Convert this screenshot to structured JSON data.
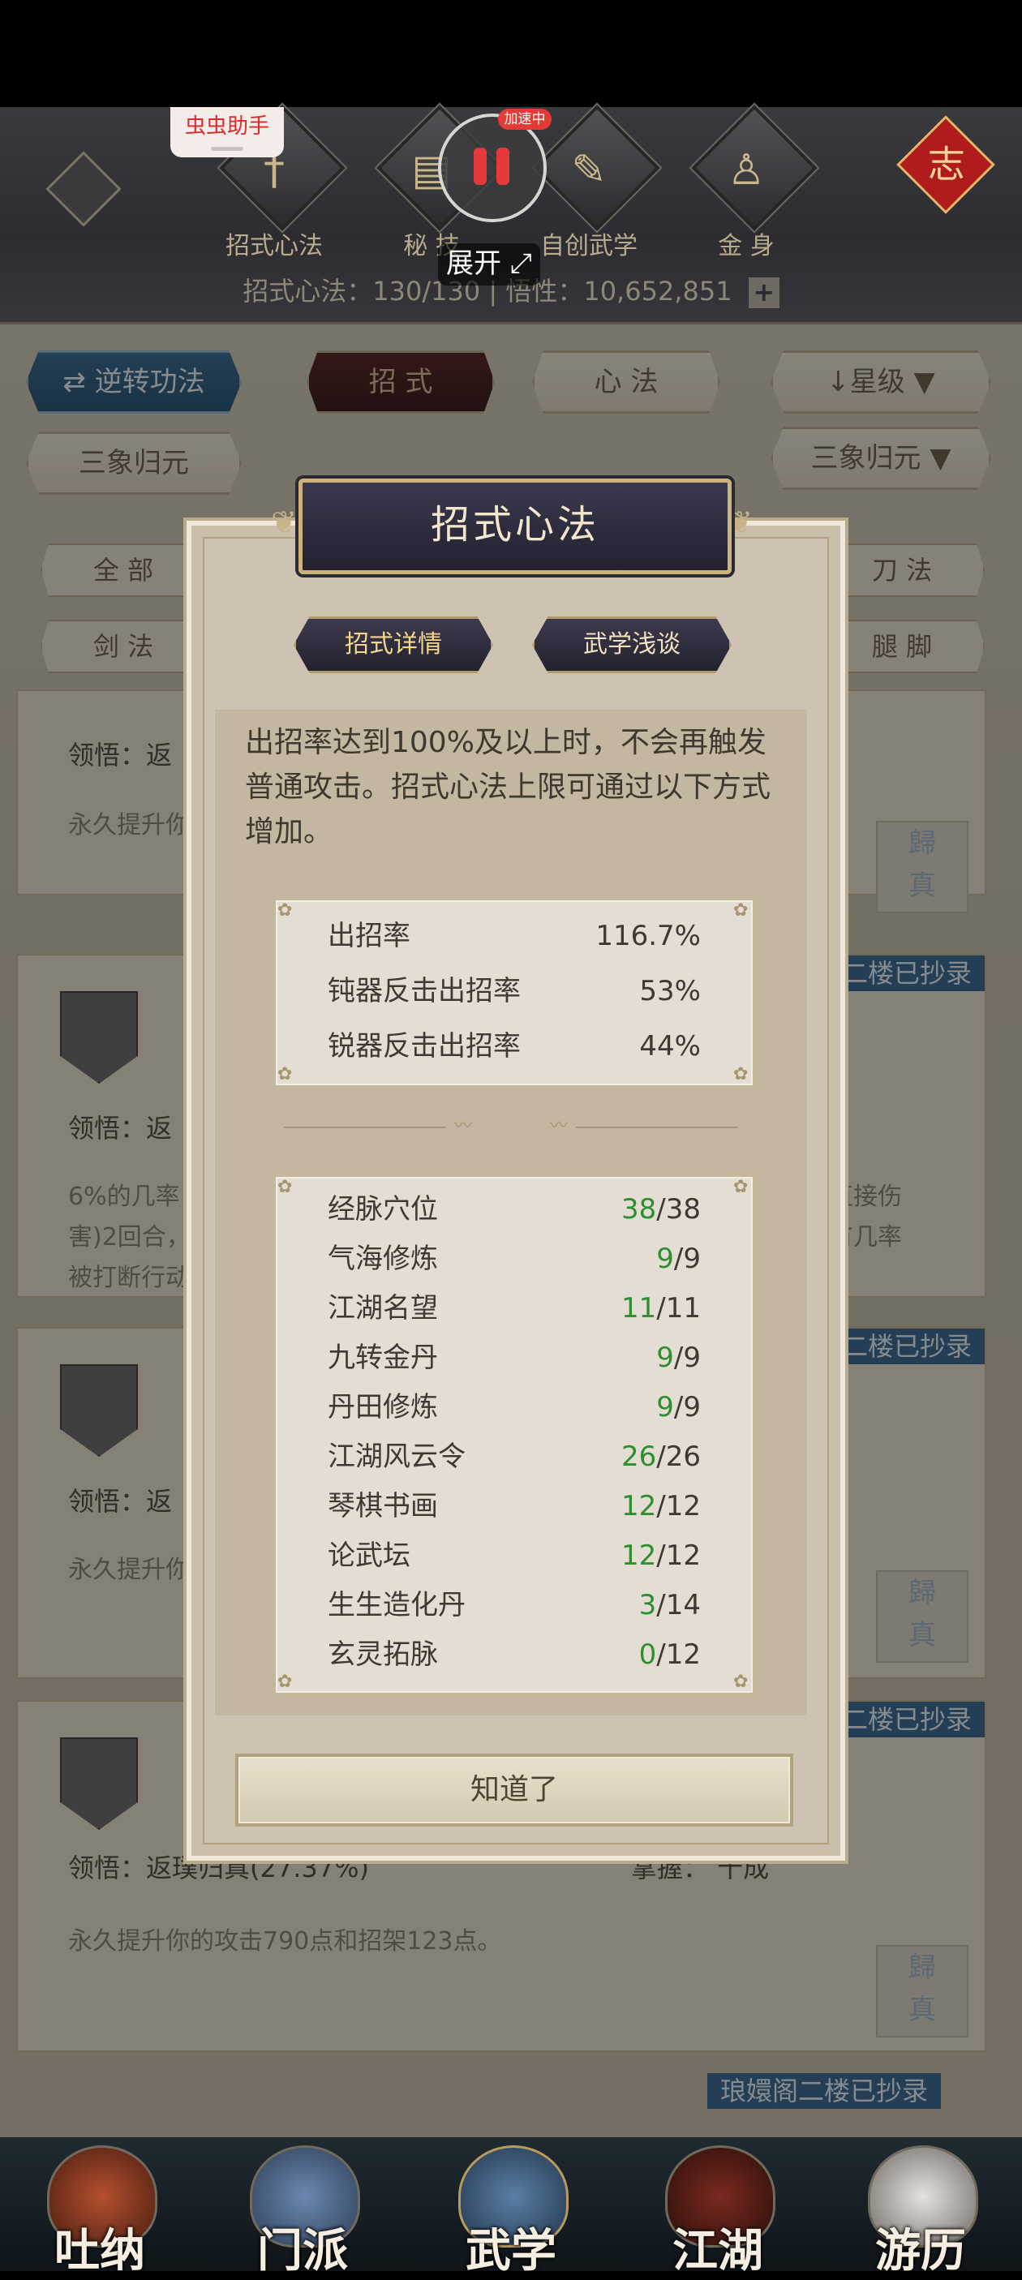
{
  "header": {
    "nav": [
      {
        "label": "招式心法",
        "icon": "sword-icon"
      },
      {
        "label": "秘  技",
        "icon": "book-icon"
      },
      {
        "label": "自创武学",
        "icon": "scroll-icon"
      },
      {
        "label": "金  身",
        "icon": "meditation-icon"
      }
    ],
    "stats_text": "招式心法：130/130  |  悟性：10,652,851",
    "plus_label": "+",
    "knot_glyph": "志"
  },
  "overlay_controls": {
    "helper_label": "虫虫助手",
    "recording_badge": "加速中",
    "expand_label": "展开"
  },
  "filters": {
    "reverse_label": "逆转功法",
    "tab_moves": "招  式",
    "tab_heart": "心  法",
    "sort_label": "星级",
    "left_select": "三象归元",
    "right_select": "三象归元",
    "cat_all": "全  部",
    "cat_blade": "刀  法",
    "cat_sword": "剑  法",
    "cat_leg": "腿  脚"
  },
  "cards": [
    {
      "realize": "领悟：返",
      "desc": "永久提升你"
    },
    {
      "realize": "领悟：返",
      "desc": "6%的几率",
      "desc2": "害)2回合，",
      "desc3": "被打断行动",
      "right1": "直接伤",
      "right2": "有几率",
      "badge": "二楼已抄录"
    },
    {
      "realize": "领悟：返",
      "desc": "永久提升你",
      "badge": "二楼已抄录"
    },
    {
      "realize": "领悟：返璞归真(27.37%)",
      "master": "掌握：  十成",
      "desc": "永久提升你的攻击790点和招架123点。",
      "badge": "二楼已抄录"
    },
    {
      "badge": "琅嬛阁二楼已抄录"
    }
  ],
  "dialog": {
    "title": "招式心法",
    "tab_detail": "招式详情",
    "tab_talk": "武学浅谈",
    "description": "出招率达到100%及以上时，不会再触发普通攻击。招式心法上限可通过以下方式增加。",
    "rates": [
      {
        "label": "出招率",
        "value": "116.7%"
      },
      {
        "label": "钝器反击出招率",
        "value": "53%"
      },
      {
        "label": "锐器反击出招率",
        "value": "44%"
      }
    ],
    "sources": [
      {
        "label": "经脉穴位",
        "current": "38",
        "max": "/38"
      },
      {
        "label": "气海修炼",
        "current": "9",
        "max": "/9"
      },
      {
        "label": "江湖名望",
        "current": "11",
        "max": "/11"
      },
      {
        "label": "九转金丹",
        "current": "9",
        "max": "/9"
      },
      {
        "label": "丹田修炼",
        "current": "9",
        "max": "/9"
      },
      {
        "label": "江湖风云令",
        "current": "26",
        "max": "/26"
      },
      {
        "label": "琴棋书画",
        "current": "12",
        "max": "/12"
      },
      {
        "label": "论武坛",
        "current": "12",
        "max": "/12"
      },
      {
        "label": "生生造化丹",
        "current": "3",
        "max": "/14"
      },
      {
        "label": "玄灵拓脉",
        "current": "0",
        "max": "/12"
      }
    ],
    "ok_label": "知道了"
  },
  "bottom_nav": [
    {
      "label": "吐纳",
      "icon": "meditate-icon"
    },
    {
      "label": "门派",
      "icon": "flags-icon"
    },
    {
      "label": "武学",
      "icon": "books-icon"
    },
    {
      "label": "江湖",
      "icon": "straw-hat-icon"
    },
    {
      "label": "游历",
      "icon": "horse-icon"
    }
  ]
}
